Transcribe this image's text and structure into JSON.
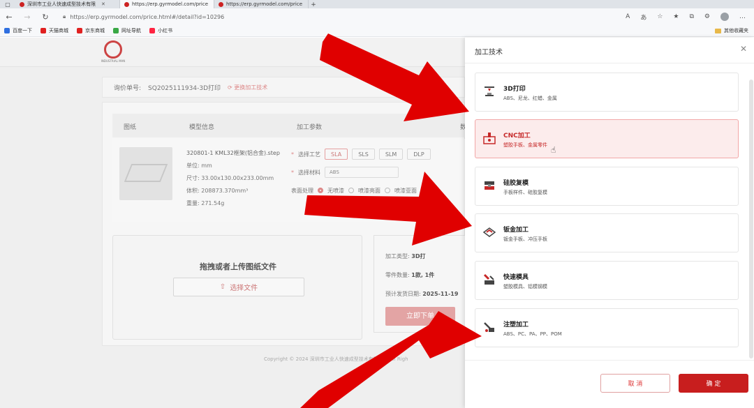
{
  "browser": {
    "tabs": [
      {
        "label": "深圳市工业人快速成型技术有限",
        "active": false
      },
      {
        "label": "https://erp.gyrmodel.com/price",
        "active": true
      },
      {
        "label": "https://erp.gyrmodel.com/price",
        "active": false
      }
    ],
    "url": "https://erp.gyrmodel.com/price.html#/detail?id=10296",
    "bookmarks": [
      {
        "label": "百度一下",
        "color": "#2f6fe0"
      },
      {
        "label": "天猫商城",
        "color": "#e02020"
      },
      {
        "label": "京东商城",
        "color": "#e02020"
      },
      {
        "label": "网址导航",
        "color": "#39a845"
      },
      {
        "label": "小红书",
        "color": "#ff2442"
      }
    ],
    "other_bookmarks": "其他收藏夹"
  },
  "page": {
    "logo_text": "INDUSTRIAL MAN",
    "quote_label": "询价单号:",
    "quote_no": "SQ2025111934-3D打印",
    "switch_tech": "更换加工技术",
    "columns": [
      "图纸",
      "模型信息",
      "加工参数",
      "数"
    ],
    "model": {
      "file_name": "320801-1 KML32框架(铝合金).step",
      "unit": "单位: mm",
      "size": "尺寸: 33.00x130.00x233.00mm",
      "volume": "体积: 208873.370mm³",
      "weight": "重量: 271.54g"
    },
    "params": {
      "process_label": "选择工艺",
      "processes": [
        "SLA",
        "SLS",
        "SLM",
        "DLP"
      ],
      "material_label": "选择材料",
      "material_value": "ABS",
      "surface_label": "表面处理",
      "surface_options": [
        "无喷漆",
        "喷漆亮面",
        "喷漆亚面"
      ]
    },
    "upload_title": "拖拽或者上传图纸文件",
    "upload_button": "选择文件",
    "summary": {
      "type_label": "加工类型:",
      "type_value": "3D打",
      "count_label": "零件数量:",
      "count_value": "1款, 1件",
      "date_label": "预计发货日期:",
      "date_value": "2025-11-19",
      "submit": "立即下单"
    },
    "footer": "Copyright © 2024 深圳市工业人快速成型技术有限公司 All Righ"
  },
  "drawer": {
    "title": "加工技术",
    "options": [
      {
        "name": "3D打印",
        "desc": "ABS、尼龙、红蜡、金属",
        "icon": "3d-printer-icon",
        "selected": false
      },
      {
        "name": "CNC加工",
        "desc": "塑胶手板、金属零件",
        "icon": "cnc-machine-icon",
        "selected": true
      },
      {
        "name": "硅胶复模",
        "desc": "手板样件、硅胶复模",
        "icon": "silicone-mold-icon",
        "selected": false
      },
      {
        "name": "钣金加工",
        "desc": "钣金手板、冲压手板",
        "icon": "sheet-metal-icon",
        "selected": false
      },
      {
        "name": "快速模具",
        "desc": "塑胶模具、铝模钢模",
        "icon": "rapid-tooling-icon",
        "selected": false
      },
      {
        "name": "注塑加工",
        "desc": "ABS、PC、PA、PP、POM",
        "icon": "injection-molding-icon",
        "selected": false
      }
    ],
    "cancel": "取 消",
    "confirm": "确 定"
  },
  "colors": {
    "accent": "#c81e1e",
    "arrow": "#e00000",
    "selected_bg": "#fcecec"
  }
}
